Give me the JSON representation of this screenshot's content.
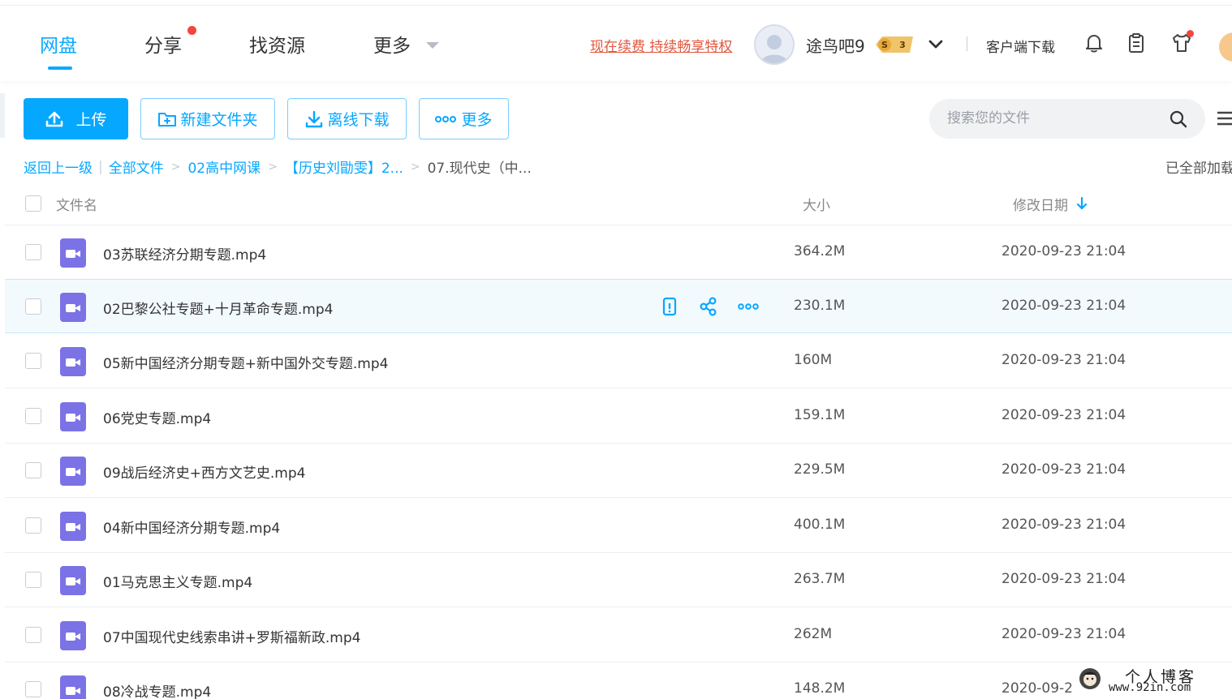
{
  "nav": {
    "items": [
      {
        "label": "网盘",
        "active": true
      },
      {
        "label": "分享",
        "has_red_dot": true
      },
      {
        "label": "找资源"
      },
      {
        "label": "更多",
        "has_caret": true
      }
    ],
    "promo_text": "现在续费 持续畅享特权",
    "username": "途鸟吧9",
    "vip_badge": "S 3",
    "client_download": "客户端下载",
    "icons": [
      "bell-icon",
      "clipboard-icon",
      "shirt-icon"
    ]
  },
  "toolbar": {
    "upload_label": "上传",
    "new_folder_label": "新建文件夹",
    "offline_download_label": "离线下载",
    "more_label": "更多",
    "search_placeholder": "搜索您的文件"
  },
  "breadcrumb": {
    "back": "返回上一级",
    "items": [
      "全部文件",
      "02高中网课",
      "【历史刘勖雯】2..."
    ],
    "current": "07.现代史（中...",
    "loaded_text": "已全部加载"
  },
  "table": {
    "columns": {
      "name": "文件名",
      "size": "大小",
      "date": "修改日期"
    },
    "sort": "date-desc",
    "rows": [
      {
        "name": "03苏联经济分期专题.mp4",
        "size": "364.2M",
        "date": "2020-09-23 21:04"
      },
      {
        "name": "02巴黎公社专题+十月革命专题.mp4",
        "size": "230.1M",
        "date": "2020-09-23 21:04",
        "hovered": true
      },
      {
        "name": "05新中国经济分期专题+新中国外交专题.mp4",
        "size": "160M",
        "date": "2020-09-23 21:04"
      },
      {
        "name": "06党史专题.mp4",
        "size": "159.1M",
        "date": "2020-09-23 21:04"
      },
      {
        "name": "09战后经济史+西方文艺史.mp4",
        "size": "229.5M",
        "date": "2020-09-23 21:04"
      },
      {
        "name": "04新中国经济分期专题.mp4",
        "size": "400.1M",
        "date": "2020-09-23 21:04"
      },
      {
        "name": "01马克思主义专题.mp4",
        "size": "263.7M",
        "date": "2020-09-23 21:04"
      },
      {
        "name": "07中国现代史线索串讲+罗斯福新政.mp4",
        "size": "262M",
        "date": "2020-09-23 21:04"
      },
      {
        "name": "08冷战专题.mp4",
        "size": "148.2M",
        "date": "2020-09-2"
      }
    ]
  },
  "watermark": {
    "title": "个人博客",
    "url": "www.92in.com"
  },
  "colors": {
    "accent": "#06a7ff",
    "promo": "#e2573e",
    "file_icon": "#7b72e6",
    "red_dot": "#f5453d"
  }
}
